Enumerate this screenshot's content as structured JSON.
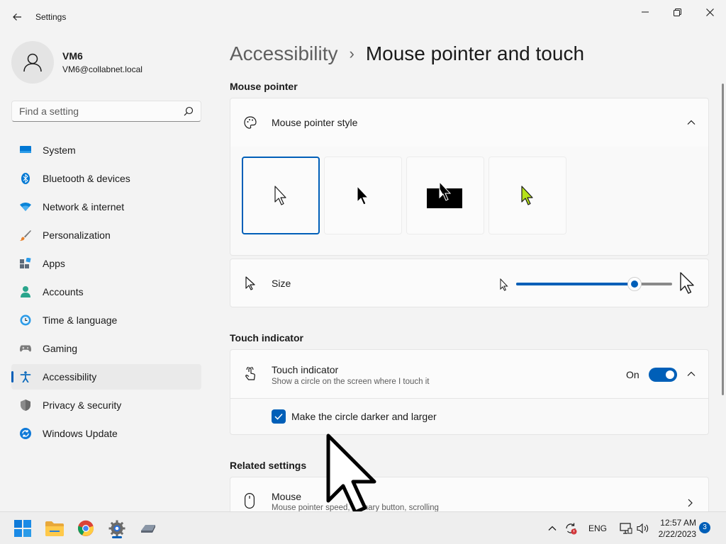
{
  "window": {
    "title": "Settings",
    "minimize_icon": "minimize-icon",
    "maximize_icon": "restore-icon",
    "close_icon": "close-icon"
  },
  "profile": {
    "name": "VM6",
    "email": "VM6@collabnet.local"
  },
  "search": {
    "placeholder": "Find a setting"
  },
  "sidebar": {
    "items": [
      {
        "label": "System",
        "icon": "system-icon"
      },
      {
        "label": "Bluetooth & devices",
        "icon": "bluetooth-icon"
      },
      {
        "label": "Network & internet",
        "icon": "network-icon"
      },
      {
        "label": "Personalization",
        "icon": "brush-icon"
      },
      {
        "label": "Apps",
        "icon": "apps-icon"
      },
      {
        "label": "Accounts",
        "icon": "accounts-icon"
      },
      {
        "label": "Time & language",
        "icon": "clock-icon"
      },
      {
        "label": "Gaming",
        "icon": "gamepad-icon"
      },
      {
        "label": "Accessibility",
        "icon": "accessibility-icon",
        "active": true
      },
      {
        "label": "Privacy & security",
        "icon": "shield-icon"
      },
      {
        "label": "Windows Update",
        "icon": "update-icon"
      }
    ]
  },
  "breadcrumb": {
    "parent": "Accessibility",
    "separator": "›",
    "current": "Mouse pointer and touch"
  },
  "mouse_pointer": {
    "section_title": "Mouse pointer",
    "style_label": "Mouse pointer style",
    "styles": [
      "white",
      "black",
      "inverted",
      "custom"
    ],
    "selected_style": "white",
    "size_label": "Size",
    "size_level": 0.76
  },
  "touch_indicator": {
    "section_title": "Touch indicator",
    "label": "Touch indicator",
    "description": "Show a circle on the screen where I touch it",
    "state": "On",
    "checkbox_label": "Make the circle darker and larger",
    "checkbox_checked": true
  },
  "related": {
    "section_title": "Related settings",
    "mouse_label": "Mouse",
    "mouse_description": "Mouse pointer speed, primary button, scrolling"
  },
  "taskbar": {
    "language": "ENG",
    "time": "12:57 AM",
    "date": "2/22/2023",
    "notifications": "3"
  },
  "colors": {
    "accent": "#005fb8",
    "background": "#f3f3f3",
    "card": "#fbfbfb"
  }
}
